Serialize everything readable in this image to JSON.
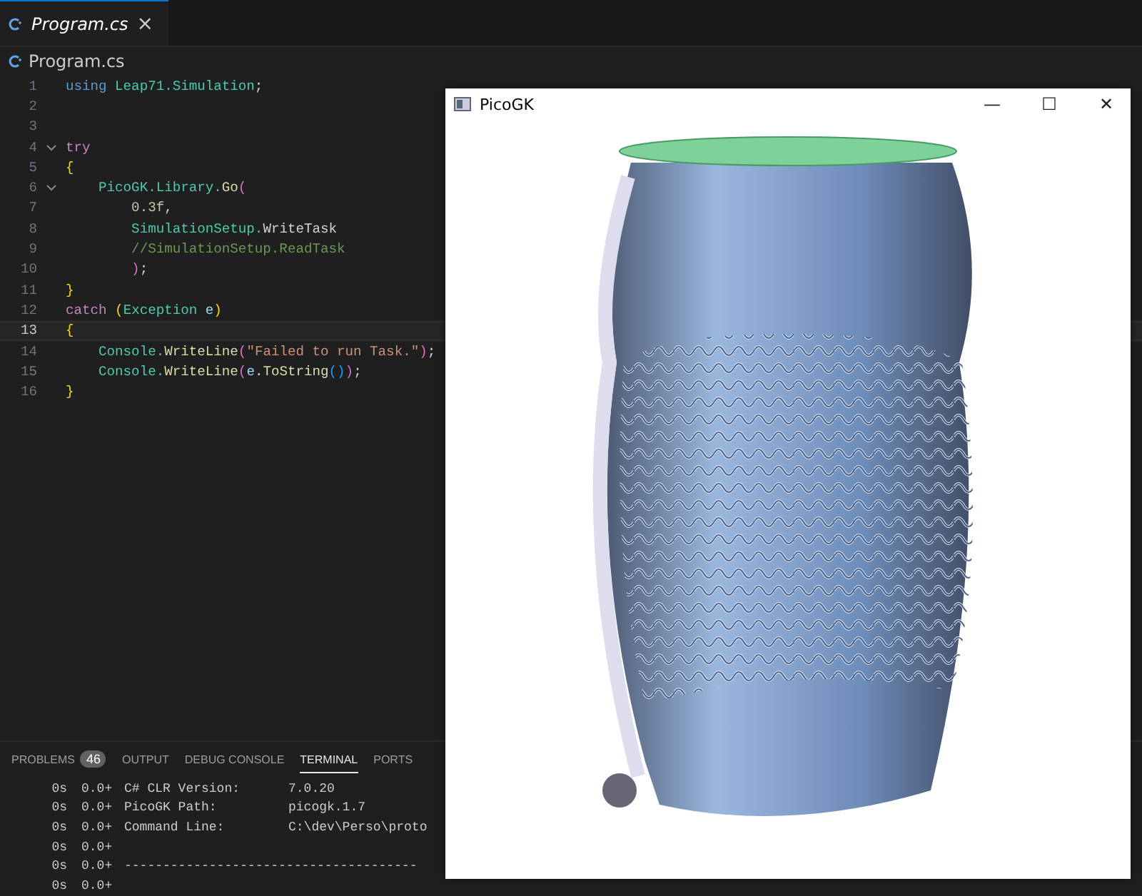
{
  "editor_tabs": [
    {
      "label": "Program.cs",
      "selected": true,
      "close": "×"
    }
  ],
  "breadcrumb": "Program.cs",
  "code_lines": [
    {
      "number": "1",
      "foldable": false,
      "current": false,
      "tokens": [
        {
          "text": "using ",
          "kind": "keyword"
        },
        {
          "text": "Leap71.Simulation",
          "kind": "type"
        },
        {
          "text": ";",
          "kind": "plain"
        }
      ]
    },
    {
      "number": "2",
      "foldable": false,
      "current": false
    },
    {
      "number": "3",
      "foldable": false,
      "current": false
    },
    {
      "number": "4",
      "foldable": true,
      "current": false,
      "tokens": [
        {
          "text": "try",
          "kind": "control"
        }
      ]
    },
    {
      "number": "5",
      "foldable": false,
      "current": false,
      "tokens": [
        {
          "text": "{",
          "kind": "bracket"
        }
      ]
    },
    {
      "number": "6",
      "foldable": true,
      "current": false,
      "tokens": [
        {
          "text": "    PicoGK.Library.",
          "kind": "type"
        },
        {
          "text": "Go",
          "kind": "func"
        },
        {
          "text": "(",
          "kind": "bracket2"
        }
      ]
    },
    {
      "number": "7",
      "foldable": false,
      "current": false,
      "tokens": [
        {
          "text": "        0.3f",
          "kind": "number"
        },
        {
          "text": ",",
          "kind": "plain"
        }
      ]
    },
    {
      "number": "8",
      "foldable": false,
      "current": false,
      "tokens": [
        {
          "text": "        SimulationSetup.",
          "kind": "type"
        },
        {
          "text": "WriteTask",
          "kind": "plain"
        }
      ]
    },
    {
      "number": "9",
      "foldable": false,
      "current": false,
      "tokens": [
        {
          "text": "        //SimulationSetup.ReadTask",
          "kind": "comment"
        }
      ]
    },
    {
      "number": "10",
      "foldable": false,
      "current": false,
      "tokens": [
        {
          "text": "        )",
          "kind": "bracket2"
        },
        {
          "text": ";",
          "kind": "plain"
        }
      ]
    },
    {
      "number": "11",
      "foldable": false,
      "current": false,
      "tokens": [
        {
          "text": "}",
          "kind": "bracket"
        }
      ]
    },
    {
      "number": "12",
      "foldable": false,
      "current": false,
      "tokens": [
        {
          "text": "catch ",
          "kind": "control"
        },
        {
          "text": "(",
          "kind": "bracket"
        },
        {
          "text": "Exception ",
          "kind": "type"
        },
        {
          "text": "e",
          "kind": "param"
        },
        {
          "text": ")",
          "kind": "bracket"
        }
      ]
    },
    {
      "number": "13",
      "foldable": false,
      "current": true,
      "tokens": [
        {
          "text": "{",
          "kind": "bracket"
        }
      ]
    },
    {
      "number": "14",
      "foldable": false,
      "current": false,
      "tokens": [
        {
          "text": "    Console.",
          "kind": "type"
        },
        {
          "text": "WriteLine",
          "kind": "func"
        },
        {
          "text": "(",
          "kind": "bracket2"
        },
        {
          "text": "\"Failed to run Task.\"",
          "kind": "string"
        },
        {
          "text": ")",
          "kind": "bracket2"
        },
        {
          "text": ";",
          "kind": "plain"
        }
      ]
    },
    {
      "number": "15",
      "foldable": false,
      "current": false,
      "tokens": [
        {
          "text": "    Console.",
          "kind": "type"
        },
        {
          "text": "WriteLine",
          "kind": "func"
        },
        {
          "text": "(",
          "kind": "bracket2"
        },
        {
          "text": "e",
          "kind": "param"
        },
        {
          "text": ".",
          "kind": "plain"
        },
        {
          "text": "ToString",
          "kind": "func"
        },
        {
          "text": "()",
          "kind": "bracket3"
        },
        {
          "text": ")",
          "kind": "bracket2"
        },
        {
          "text": ";",
          "kind": "plain"
        }
      ]
    },
    {
      "number": "16",
      "foldable": false,
      "current": false,
      "tokens": [
        {
          "text": "}",
          "kind": "bracket"
        }
      ]
    }
  ],
  "panel_tabs": [
    {
      "label": "PROBLEMS",
      "selected": false,
      "badge": "46"
    },
    {
      "label": "OUTPUT",
      "selected": false
    },
    {
      "label": "DEBUG CONSOLE",
      "selected": false
    },
    {
      "label": "TERMINAL",
      "selected": true
    },
    {
      "label": "PORTS",
      "selected": false
    }
  ],
  "terminal_lines": [
    {
      "time": "0s",
      "mem": "0.0+",
      "label": "C# CLR Version:",
      "value": "7.0.20"
    },
    {
      "time": "0s",
      "mem": "0.0+",
      "label": "PicoGK Path:",
      "value": "picogk.1.7"
    },
    {
      "time": "0s",
      "mem": "0.0+",
      "label": "Command Line:",
      "value": "C:\\dev\\Perso\\proto"
    },
    {
      "time": "0s",
      "mem": "0.0+"
    },
    {
      "time": "0s",
      "mem": "0.0+",
      "label": "--------------------------------------"
    },
    {
      "time": "0s",
      "mem": "0.0+"
    }
  ],
  "viewer_window": {
    "title": "PicoGK",
    "controls": [
      "—",
      "☐",
      "✕"
    ]
  }
}
